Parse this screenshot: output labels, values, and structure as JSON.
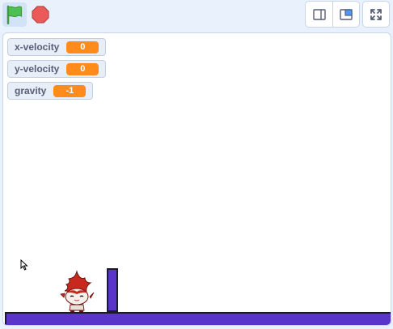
{
  "icons": {
    "green_flag": "green-flag-icon",
    "stop": "stop-sign-icon",
    "small_stage": "small-stage-layout-icon",
    "large_stage": "large-stage-layout-icon",
    "fullscreen": "fullscreen-icon",
    "cursor": "mouse-pointer-icon"
  },
  "colors": {
    "flag_green": "#4cbf56",
    "stop_red": "#ec5959",
    "monitor_value_orange": "#ff8c1a",
    "platform_purple": "#5b34c9",
    "accent_blue": "#4c97ff"
  },
  "monitors": [
    {
      "label": "x-velocity",
      "value": "0"
    },
    {
      "label": "y-velocity",
      "value": "0"
    },
    {
      "label": "gravity",
      "value": "-1"
    }
  ]
}
